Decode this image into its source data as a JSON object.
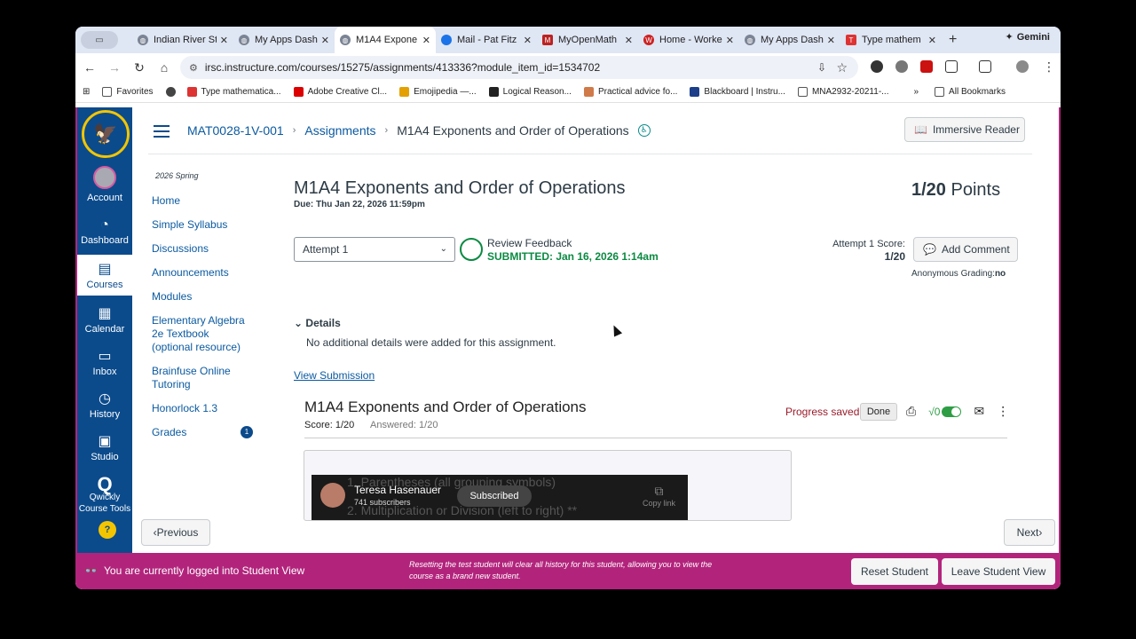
{
  "browser": {
    "tabs": [
      {
        "title": "Indian River St",
        "active": false
      },
      {
        "title": "My Apps Dash",
        "active": false
      },
      {
        "title": "M1A4 Expone",
        "active": true
      },
      {
        "title": "Mail - Pat Fitz",
        "active": false
      },
      {
        "title": "MyOpenMath",
        "active": false
      },
      {
        "title": "Home - Worke",
        "active": false
      },
      {
        "title": "My Apps Dash",
        "active": false
      },
      {
        "title": "Type mathem",
        "active": false
      }
    ],
    "gemini_label": "Gemini",
    "url": "irsc.instructure.com/courses/15275/assignments/413336?module_item_id=1534702",
    "bookmarks": [
      "Favorites",
      "Type mathematica...",
      "Adobe Creative Cl...",
      "Emojipedia —...",
      "Logical Reason...",
      "Practical advice fo...",
      "Blackboard | Instru...",
      "MNA2932-20211-..."
    ],
    "all_bookmarks": "All Bookmarks"
  },
  "global_nav": {
    "items": [
      {
        "label": "Account"
      },
      {
        "label": "Dashboard"
      },
      {
        "label": "Courses"
      },
      {
        "label": "Calendar"
      },
      {
        "label": "Inbox"
      },
      {
        "label": "History"
      },
      {
        "label": "Studio"
      },
      {
        "label": "Qwickly Course Tools"
      }
    ]
  },
  "header": {
    "breadcrumb": [
      "MAT0028-1V-001",
      "Assignments",
      "M1A4 Exponents and Order of Operations"
    ],
    "immersive_reader": "Immersive Reader"
  },
  "course_nav": {
    "term": "2026 Spring",
    "items": [
      "Home",
      "Simple Syllabus",
      "Discussions",
      "Announcements",
      "Modules",
      "Elementary Algebra 2e Textbook (optional resource)",
      "Brainfuse Online Tutoring",
      "Honorlock 1.3",
      "Grades"
    ],
    "grades_badge": "1"
  },
  "assignment": {
    "title": "M1A4 Exponents and Order of Operations",
    "due": "Due: Thu Jan 22, 2026 11:59pm",
    "points_score": "1/20",
    "points_label": "Points",
    "attempt_select": "Attempt 1",
    "review_feedback": "Review Feedback",
    "submitted": "SUBMITTED: Jan 16, 2026 1:14am",
    "attempt_score_label": "Attempt 1 Score:",
    "attempt_score_value": "1/20",
    "add_comment": "Add Comment",
    "anon_label": "Anonymous Grading:",
    "anon_value": "no",
    "details_label": "Details",
    "details_body": "No additional details were added for this assignment.",
    "view_submission": "View Submission"
  },
  "myopenmath": {
    "title": "M1A4 Exponents and Order of Operations",
    "score": "Score: 1/20",
    "answered": "Answered: 1/20",
    "progress": "Progress saved",
    "done": "Done",
    "video": {
      "bg_line1": "1. Parentheses (all grouping symbols)",
      "bg_line2": "2. Multiplication or Division (left to right) **",
      "channel": "Teresa Hasenauer",
      "subscribers": "741 subscribers",
      "subscribed": "Subscribed",
      "copy_link": "Copy link"
    }
  },
  "footer_nav": {
    "previous": "Previous",
    "next": "Next"
  },
  "student_view": {
    "message": "You are currently logged into Student View",
    "note": "Resetting the test student will clear all history for this student, allowing you to view the course as a brand new student.",
    "reset": "Reset Student",
    "leave": "Leave Student View"
  },
  "colors": {
    "brand": "#0b4b8c",
    "student_bar": "#b2247c",
    "success": "#0b8a42",
    "progress": "#9a1c2a"
  }
}
